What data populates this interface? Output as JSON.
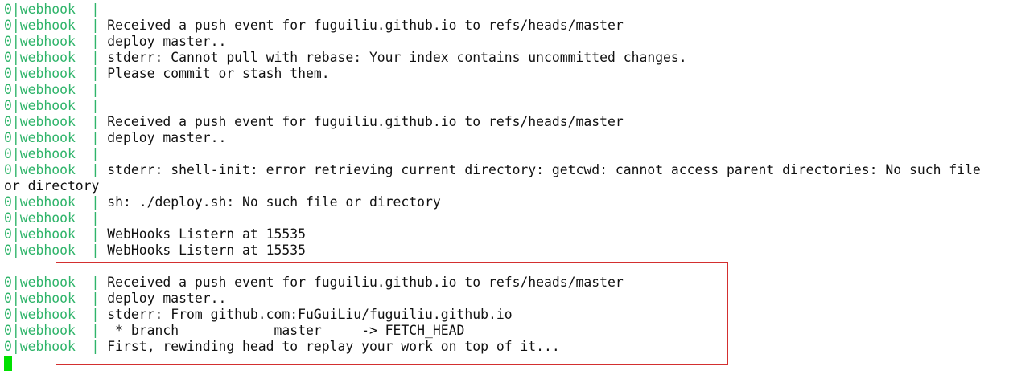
{
  "terminal": {
    "lines": [
      {
        "prefix": "0|webhook ",
        "sep": " | ",
        "text": "",
        "wrap": false
      },
      {
        "prefix": "0|webhook ",
        "sep": " | ",
        "text": "Received a push event for fuguiliu.github.io to refs/heads/master",
        "wrap": false
      },
      {
        "prefix": "0|webhook ",
        "sep": " | ",
        "text": "deploy master..",
        "wrap": false
      },
      {
        "prefix": "0|webhook ",
        "sep": " | ",
        "text": "stderr: Cannot pull with rebase: Your index contains uncommitted changes.",
        "wrap": false
      },
      {
        "prefix": "0|webhook ",
        "sep": " | ",
        "text": "Please commit or stash them.",
        "wrap": false
      },
      {
        "prefix": "0|webhook ",
        "sep": " | ",
        "text": "",
        "wrap": false
      },
      {
        "prefix": "0|webhook ",
        "sep": " | ",
        "text": "",
        "wrap": false
      },
      {
        "prefix": "0|webhook ",
        "sep": " | ",
        "text": "Received a push event for fuguiliu.github.io to refs/heads/master",
        "wrap": false
      },
      {
        "prefix": "0|webhook ",
        "sep": " | ",
        "text": "deploy master..",
        "wrap": false
      },
      {
        "prefix": "0|webhook ",
        "sep": " | ",
        "text": "",
        "wrap": false
      },
      {
        "prefix": "0|webhook ",
        "sep": " | ",
        "text": "stderr: shell-init: error retrieving current directory: getcwd: cannot access parent directories: No such file",
        "wrap": false
      },
      {
        "prefix": "",
        "sep": "",
        "text": "or directory",
        "wrap": true
      },
      {
        "prefix": "0|webhook ",
        "sep": " | ",
        "text": "sh: ./deploy.sh: No such file or directory",
        "wrap": false
      },
      {
        "prefix": "0|webhook ",
        "sep": " | ",
        "text": "",
        "wrap": false
      },
      {
        "prefix": "0|webhook ",
        "sep": " | ",
        "text": "WebHooks Listern at 15535",
        "wrap": false
      },
      {
        "prefix": "0|webhook ",
        "sep": " | ",
        "text": "WebHooks Listern at 15535",
        "wrap": false
      },
      {
        "prefix": "",
        "sep": "",
        "text": "",
        "wrap": true
      },
      {
        "prefix": "0|webhook ",
        "sep": " | ",
        "text": "Received a push event for fuguiliu.github.io to refs/heads/master",
        "wrap": false
      },
      {
        "prefix": "0|webhook ",
        "sep": " | ",
        "text": "deploy master..",
        "wrap": false
      },
      {
        "prefix": "0|webhook ",
        "sep": " | ",
        "text": "stderr: From github.com:FuGuiLiu/fuguiliu.github.io",
        "wrap": false
      },
      {
        "prefix": "0|webhook ",
        "sep": " | ",
        "text": " * branch            master     -> FETCH_HEAD",
        "wrap": false
      },
      {
        "prefix": "0|webhook ",
        "sep": " | ",
        "text": "First, rewinding head to replay your work on top of it...",
        "wrap": false
      }
    ]
  }
}
